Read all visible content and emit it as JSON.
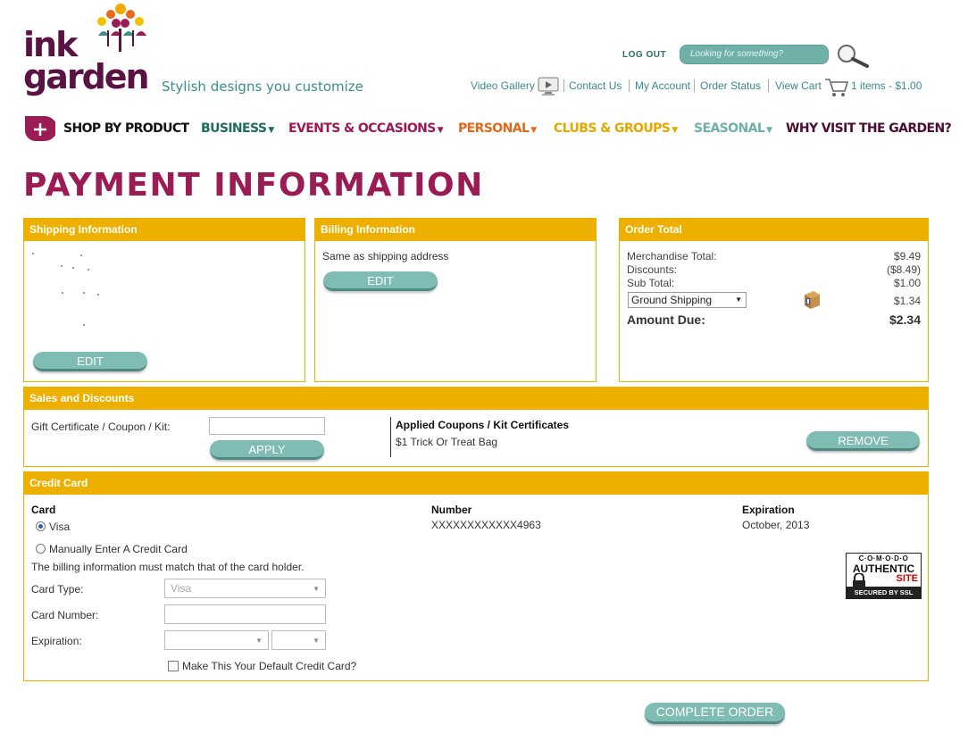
{
  "brand": {
    "logo_top": "ink",
    "logo_bottom": "garden",
    "tagline": "Stylish designs you customize"
  },
  "header": {
    "logout": "LOG OUT",
    "search_placeholder": "Looking for something?",
    "links": {
      "video_gallery": "Video Gallery",
      "contact_us": "Contact Us",
      "my_account": "My Account",
      "order_status": "Order Status",
      "view_cart": "View Cart",
      "cart_summary": "1 items - $1.00"
    }
  },
  "nav": {
    "shop_by_product": "SHOP BY PRODUCT",
    "business": "BUSINESS",
    "events": "EVENTS & OCCASIONS",
    "personal": "PERSONAL",
    "clubs": "CLUBS & GROUPS",
    "seasonal": "SEASONAL",
    "why_visit": "WHY VISIT THE GARDEN?"
  },
  "colors": {
    "brand_plum": "#5a1242",
    "title_magenta": "#9b1b55",
    "teal": "#3c8a83",
    "panel_gold": "#eeb000",
    "nav_business": "#1f6d5a",
    "nav_events": "#9b1b55",
    "nav_personal": "#e06a1a",
    "nav_clubs": "#e3a800",
    "nav_seasonal": "#6fb0a8",
    "nav_why": "#4a0e32"
  },
  "page": {
    "title": "PAYMENT INFORMATION"
  },
  "shipping": {
    "header": "Shipping Information",
    "edit": "EDIT"
  },
  "billing": {
    "header": "Billing Information",
    "text": "Same as shipping address",
    "edit": "EDIT"
  },
  "order_total": {
    "header": "Order Total",
    "merchandise_label": "Merchandise Total:",
    "merchandise_value": "$9.49",
    "discounts_label": "Discounts:",
    "discounts_value": "($8.49)",
    "subtotal_label": "Sub Total:",
    "subtotal_value": "$1.00",
    "shipping_method": "Ground Shipping",
    "shipping_value": "$1.34",
    "amount_due_label": "Amount Due:",
    "amount_due_value": "$2.34"
  },
  "sales": {
    "header": "Sales and Discounts",
    "coupon_label": "Gift Certificate / Coupon / Kit:",
    "apply": "APPLY",
    "applied_header": "Applied Coupons / Kit Certificates",
    "applied_item": "$1 Trick Or Treat Bag",
    "remove": "REMOVE"
  },
  "credit_card": {
    "header": "Credit Card",
    "card_col": "Card",
    "number_col": "Number",
    "expiration_col": "Expiration",
    "saved_card_type": "Visa",
    "saved_card_number": "XXXXXXXXXXXX4963",
    "saved_card_expiration": "October, 2013",
    "manual_option": "Manually Enter A Credit Card",
    "billing_note": "The billing information must match that of the card holder.",
    "card_type_label": "Card Type:",
    "card_type_value": "Visa",
    "card_number_label": "Card Number:",
    "expiration_label": "Expiration:",
    "default_checkbox": "Make This Your Default Credit Card?",
    "seal_top": "C·O·M·O·D·O",
    "seal_mid1": "AUTHENTIC",
    "seal_mid2": "SITE",
    "seal_bottom": "SECURED BY SSL"
  },
  "actions": {
    "complete_order": "COMPLETE ORDER"
  }
}
